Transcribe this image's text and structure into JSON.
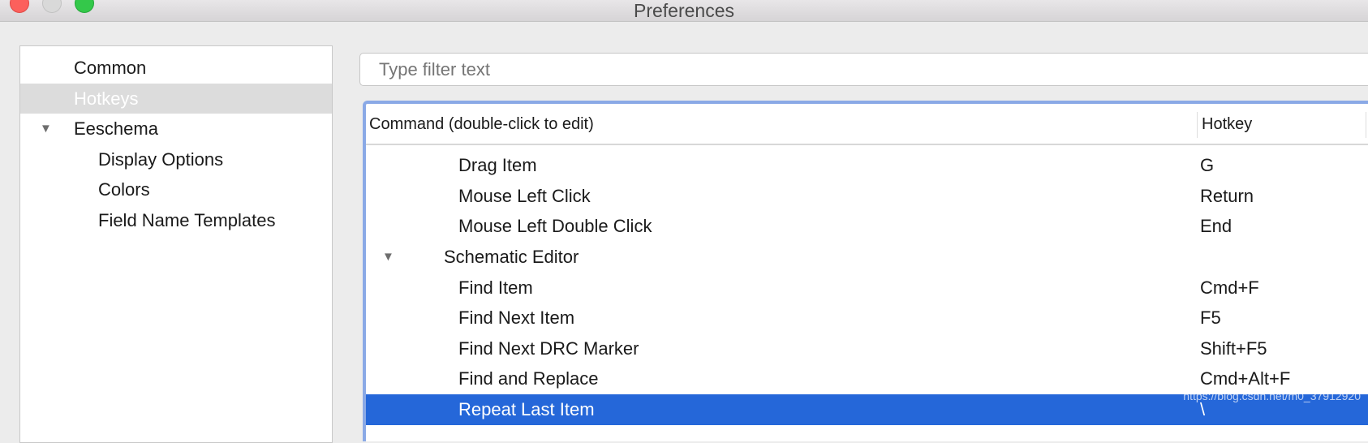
{
  "window": {
    "title": "Preferences"
  },
  "sidebar": {
    "items": [
      {
        "label": "Common",
        "level": 0,
        "selected": false
      },
      {
        "label": "Hotkeys",
        "level": 0,
        "selected": true
      },
      {
        "label": "Eeschema",
        "level": 0,
        "expanded": true
      },
      {
        "label": "Display Options",
        "level": 1
      },
      {
        "label": "Colors",
        "level": 1
      },
      {
        "label": "Field Name Templates",
        "level": 1
      }
    ]
  },
  "filter": {
    "placeholder": "Type filter text",
    "value": ""
  },
  "table": {
    "columns": [
      "Command (double-click to edit)",
      "Hotkey"
    ],
    "rows": [
      {
        "command": "Drag Item",
        "hotkey": "G"
      },
      {
        "command": "Mouse Left Click",
        "hotkey": "Return"
      },
      {
        "command": "Mouse Left Double Click",
        "hotkey": "End"
      },
      {
        "command": "Schematic Editor",
        "hotkey": "",
        "section": true
      },
      {
        "command": "Find Item",
        "hotkey": "Cmd+F"
      },
      {
        "command": "Find Next Item",
        "hotkey": "F5"
      },
      {
        "command": "Find Next DRC Marker",
        "hotkey": "Shift+F5"
      },
      {
        "command": "Find and Replace",
        "hotkey": "Cmd+Alt+F"
      },
      {
        "command": "Repeat Last Item",
        "hotkey": "\\",
        "selected": true
      }
    ]
  },
  "watermark": "https://blog.csdn.net/m0_37912920",
  "colors": {
    "selection": "#2567d9",
    "focus_ring": "#8aa9e6"
  }
}
